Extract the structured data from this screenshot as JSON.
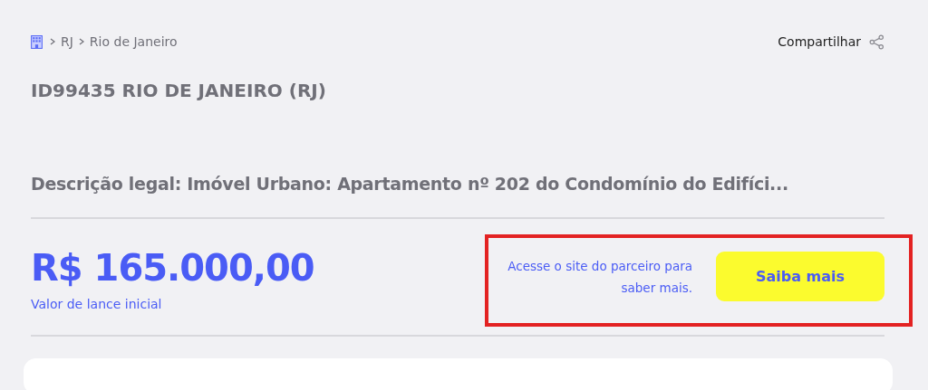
{
  "breadcrumb": [
    "RJ",
    "Rio de Janeiro"
  ],
  "share": {
    "label": "Compartilhar"
  },
  "title": "ID99435 RIO DE JANEIRO (RJ)",
  "description": "Descrição legal: Imóvel Urbano: Apartamento nº 202 do Condomínio do Edifíci...",
  "price": {
    "value": "R$ 165.000,00",
    "label": "Valor de lance inicial"
  },
  "partner": {
    "text": "Acesse o site do parceiro para saber mais.",
    "button": "Saiba mais",
    "highlighted": true
  }
}
